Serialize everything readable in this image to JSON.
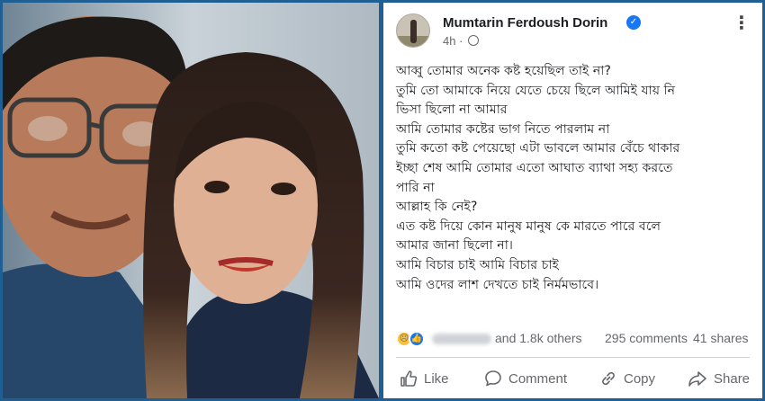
{
  "post": {
    "author": "Mumtarin Ferdoush Dorin",
    "time": "4h",
    "lines": [
      "আব্বু তোমার অনেক কষ্ট হয়েছিল তাই না?",
      "তুমি তো আমাকে নিয়ে যেতে চেয়ে ছিলে আমিই যায় নি",
      "ভিসা ছিলো না আমার",
      "আমি তোমার কষ্টের ভাগ নিতে পারলাম না",
      "তুমি কতো কষ্ট পেয়েছো এটা ভাবলে আমার বেঁচে থাকার",
      "ইচ্ছা শেষ আমি তোমার এতো আঘাত ব্যাথা সহ্য করতে",
      "পারি না",
      "আল্লাহ কি নেই?",
      "এত কষ্ট দিয়ে কোন মানুষ মানুষ কে মারতে পারে বলে",
      "আমার জানা ছিলো না।",
      "আমি বিচার চাই আমি বিচার চাই",
      "আমি ওদের লাশ দেখতে চাই নির্মমভাবে।"
    ],
    "reactions_others": "and 1.8k others",
    "comments": "295 comments",
    "shares": "41 shares"
  },
  "actions": {
    "like": "Like",
    "comment": "Comment",
    "copy": "Copy",
    "share": "Share"
  },
  "icons": {
    "verified": "verified-badge-icon",
    "globe": "globe-icon",
    "more": "more-options-icon",
    "reaction_sad": "sad-reaction-icon",
    "reaction_like": "like-reaction-icon"
  },
  "colors": {
    "frame": "#1f5f93",
    "verified": "#1877f2",
    "text": "#1c1e21",
    "muted": "#65676b"
  }
}
